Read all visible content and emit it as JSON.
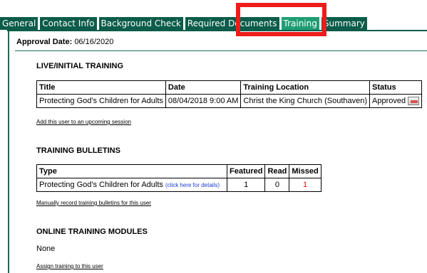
{
  "tabs": [
    {
      "label": "General"
    },
    {
      "label": "Contact Info"
    },
    {
      "label": "Background Check"
    },
    {
      "label": "Required Documents"
    },
    {
      "label": "Training",
      "active": true
    },
    {
      "label": "Summary"
    }
  ],
  "approval": {
    "label": "Approval Date:",
    "value": "06/16/2020"
  },
  "live_training": {
    "title": "LIVE/INITIAL TRAINING",
    "headers": [
      "Title",
      "Date",
      "Training Location",
      "Status"
    ],
    "row": {
      "title": "Protecting God's Children for Adults",
      "date": "08/04/2018 9:00 AM",
      "location": "Christ the King Church (Southaven)",
      "status": "Approved"
    },
    "add_link": "Add this user to an upcoming session"
  },
  "bulletins": {
    "title": "TRAINING BULLETINS",
    "headers": [
      "Type",
      "Featured",
      "Read",
      "Missed"
    ],
    "row": {
      "type": "Protecting God's Children for Adults",
      "details_link": "(click here for details)",
      "featured": "1",
      "read": "0",
      "missed": "1"
    },
    "record_link": "Manually record training bulletins for this user"
  },
  "online_modules": {
    "title": "ONLINE TRAINING MODULES",
    "none": "None",
    "assign_link": "Assign training to this user"
  },
  "colors": {
    "tab": "#0b5c4a",
    "tab_active": "#1f9e73",
    "highlight": "#ef1c1c",
    "link": "#1a3fd6",
    "missed": "#dd1111"
  }
}
